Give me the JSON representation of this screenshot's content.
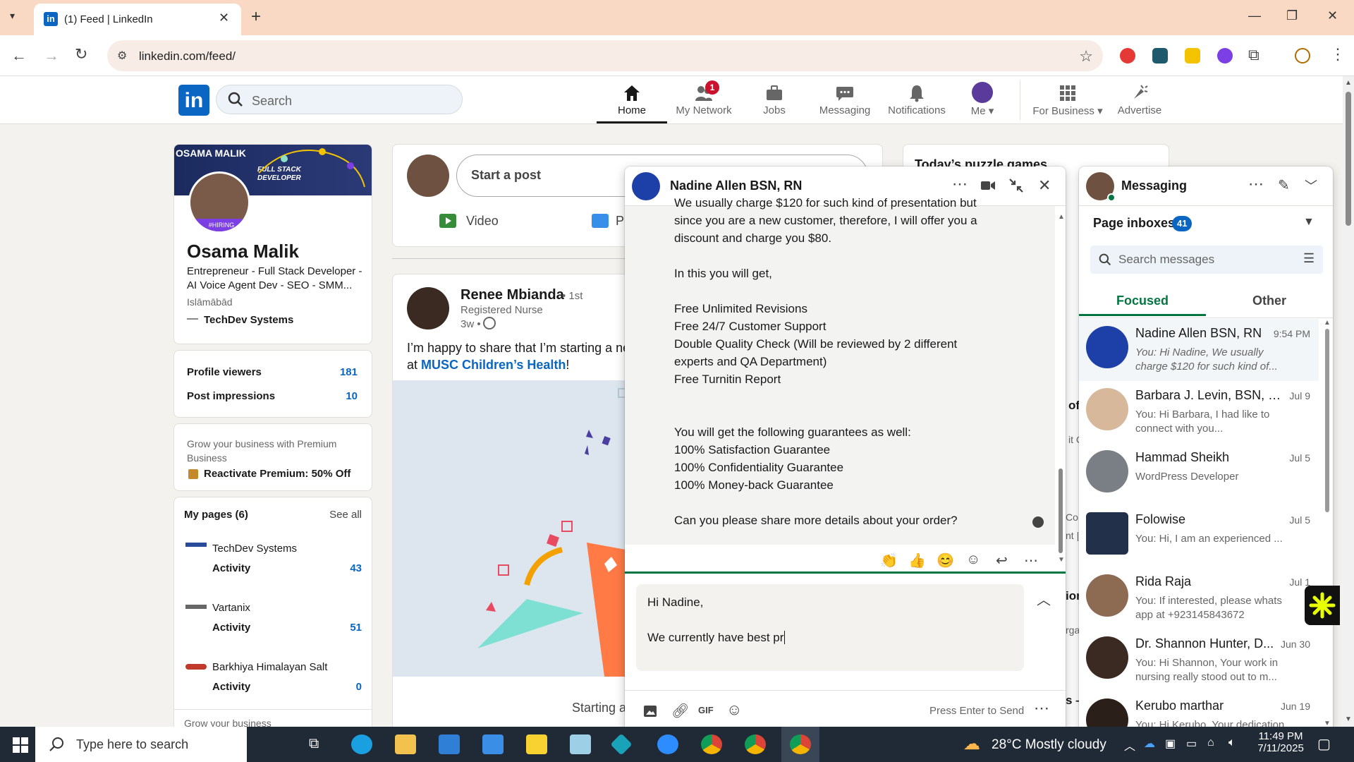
{
  "browser": {
    "tab_title": "(1) Feed | LinkedIn",
    "url": "linkedin.com/feed/"
  },
  "nav": {
    "search_placeholder": "Search",
    "items": [
      {
        "label": "Home",
        "icon": "home-icon",
        "active": true
      },
      {
        "label": "My Network",
        "icon": "people-icon",
        "badge": "1"
      },
      {
        "label": "Jobs",
        "icon": "briefcase-icon"
      },
      {
        "label": "Messaging",
        "icon": "chat-icon"
      },
      {
        "label": "Notifications",
        "icon": "bell-icon"
      },
      {
        "label": "Me",
        "icon": "avatar"
      },
      {
        "label": "For Business",
        "icon": "grid-icon"
      },
      {
        "label": "Advertise",
        "icon": "advertise-icon"
      }
    ]
  },
  "profile": {
    "banner_text": "OSAMA MALIK",
    "banner_tag": "FULL STACK DEVELOPER",
    "name": "Osama Malik",
    "headline": "Entrepreneur - Full Stack Developer - AI Voice Agent Dev - SEO - SMM...",
    "location": "Islāmābād",
    "company": "TechDev Systems",
    "hiring": "#HIRING",
    "stats": [
      {
        "label": "Profile viewers",
        "value": "181"
      },
      {
        "label": "Post impressions",
        "value": "10"
      }
    ],
    "premium_text": "Grow your business with Premium Business",
    "premium_link": "Reactivate Premium: 50% Off",
    "pages_title": "My pages (6)",
    "see_all": "See all",
    "pages": [
      {
        "name": "TechDev Systems",
        "activity": "Activity",
        "count": "43"
      },
      {
        "name": "Vartanix",
        "activity": "Activity",
        "count": "51"
      },
      {
        "name": "Barkhiya Himalayan Salt",
        "activity": "Activity",
        "count": "0"
      }
    ],
    "grow": "Grow your business"
  },
  "feed": {
    "start_post": "Start a post",
    "video": "Video",
    "photo": "P",
    "post": {
      "author": "Renee Mbianda",
      "degree": "• 1st",
      "title": "Registered Nurse",
      "time": "3w •",
      "text": "I’m happy to share that I’m starting a ne",
      "text2": "at ",
      "link": "MUSC Children’s Health",
      "text3": "!",
      "footer": "Starting a"
    }
  },
  "right_rail": {
    "title": "Today’s puzzle games",
    "frag1": "of",
    "frag2": "it C",
    "frag3": "ion",
    "frag4": "rga",
    "frag5": "Co",
    "frag6": "nt |",
    "frag7": "s –"
  },
  "chat": {
    "name": "Nadine Allen BSN, RN",
    "lines": [
      "We usually charge $120 for such kind of presentation but",
      "since you are a new customer, therefore, I will offer you a",
      "discount and charge you $80.",
      "",
      "In this you will get,",
      "",
      "Free Unlimited Revisions",
      "Free 24/7 Customer Support",
      "Double Quality Check (Will be reviewed by 2 different",
      "experts and QA Department)",
      "Free Turnitin Report",
      "",
      "",
      "You will get the following guarantees as well:",
      "100% Satisfaction Guarantee",
      "100% Confidentiality Guarantee",
      "100% Money-back Guarantee",
      "",
      "Can you please share more details about your order?"
    ],
    "compose_line1": "Hi Nadine,",
    "compose_line2": "We currently have best pr",
    "press_enter": "Press Enter to Send"
  },
  "messaging": {
    "title": "Messaging",
    "inbox_label": "Page inboxes",
    "inbox_count": "41",
    "search_placeholder": "Search messages",
    "tabs": [
      "Focused",
      "Other"
    ],
    "conversations": [
      {
        "name": "Nadine Allen BSN, RN",
        "date": "9:54 PM",
        "preview": "You: Hi Nadine, We usually charge $120 for such kind of...",
        "color": "#1d3fa8"
      },
      {
        "name": "Barbara J. Levin, BSN, RN...",
        "date": "Jul 9",
        "preview": "You: Hi Barbara, I had like to connect with you...",
        "color": "#d8b89a"
      },
      {
        "name": "Hammad Sheikh",
        "date": "Jul 5",
        "preview": "WordPress Developer",
        "color": "#7a7f86"
      },
      {
        "name": "Folowise",
        "date": "Jul 5",
        "preview": "You: Hi, I am an experienced ...",
        "color": "#23304a"
      },
      {
        "name": "Rida Raja",
        "date": "Jul 1",
        "preview": "You: If interested, please whats app at +923145843672",
        "color": "#8c6b52"
      },
      {
        "name": "Dr. Shannon Hunter, D...",
        "date": "Jun 30",
        "preview": "You: Hi Shannon, Your work in nursing really stood out to m...",
        "color": "#3a2a22"
      },
      {
        "name": "Kerubo marthar",
        "date": "Jun 19",
        "preview": "You: Hi Kerubo, Your dedication",
        "color": "#2b1f1a"
      }
    ]
  },
  "taskbar": {
    "search_placeholder": "Type here to search",
    "weather": "28°C  Mostly cloudy",
    "time": "11:49 PM",
    "date": "7/11/2025"
  }
}
